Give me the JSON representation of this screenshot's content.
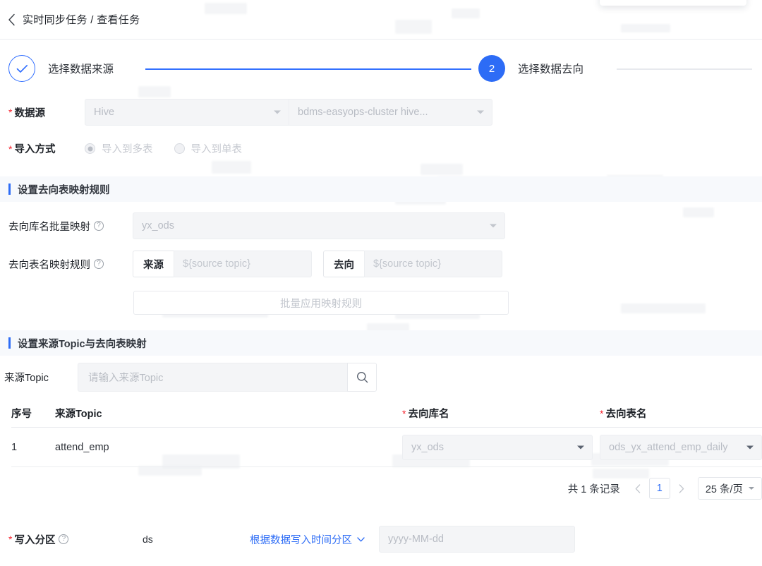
{
  "breadcrumb": {
    "back_icon": "chevron-left-icon",
    "text": "实时同步任务 / 查看任务"
  },
  "steps": [
    {
      "index": "1",
      "label": "选择数据来源",
      "state": "done",
      "icon": "check-icon"
    },
    {
      "index": "2",
      "label": "选择数据去向",
      "state": "active"
    }
  ],
  "form": {
    "datasource": {
      "label": "数据源",
      "required": "*",
      "type_value": "Hive",
      "instance_value": "bdms-easyops-cluster hive..."
    },
    "import_mode": {
      "label": "导入方式",
      "required": "*",
      "options": [
        {
          "label": "导入到多表",
          "checked": true
        },
        {
          "label": "导入到单表",
          "checked": false
        }
      ]
    }
  },
  "mapping_section": {
    "title": "设置去向表映射规则",
    "db_batch_map": {
      "label": "去向库名批量映射",
      "help_icon": "question-circle-icon",
      "value": "yx_ods"
    },
    "table_name_rule": {
      "label": "去向表名映射规则",
      "help_icon": "question-circle-icon",
      "source_addon": "来源",
      "source_placeholder": "${source topic}",
      "dest_addon": "去向",
      "dest_placeholder": "${source topic}"
    },
    "apply_button": "批量应用映射规则"
  },
  "topic_section": {
    "title": "设置来源Topic与去向表映射",
    "search": {
      "label": "来源Topic",
      "placeholder": "请输入来源Topic",
      "value": "",
      "search_icon": "search-icon"
    },
    "table": {
      "columns": [
        {
          "key": "index",
          "label": "序号",
          "required": ""
        },
        {
          "key": "topic",
          "label": "来源Topic",
          "required": ""
        },
        {
          "key": "db",
          "label": "去向库名",
          "required": "*"
        },
        {
          "key": "table",
          "label": "去向表名",
          "required": "*"
        }
      ],
      "rows": [
        {
          "index": "1",
          "topic": "attend_emp",
          "db": "yx_ods",
          "table": "ods_yx_attend_emp_daily"
        }
      ]
    },
    "pagination": {
      "total_text": "共 1 条记录",
      "prev_icon": "chevron-left-icon",
      "next_icon": "chevron-right-icon",
      "current_page": "1",
      "page_size": "25 条/页",
      "page_size_icon": "chevron-down-icon"
    }
  },
  "partition": {
    "label": "写入分区",
    "required": "*",
    "help_icon": "question-circle-icon",
    "key": "ds",
    "mode": "根据数据写入时间分区",
    "mode_icon": "chevron-down-icon",
    "format_placeholder": "yyyy-MM-dd"
  },
  "colors": {
    "accent": "#2d6cf6",
    "step_done": "#3370ff",
    "required": "#f5222d",
    "disabled_bg": "#f4f5f7",
    "section_bg": "#f7f9fc"
  }
}
